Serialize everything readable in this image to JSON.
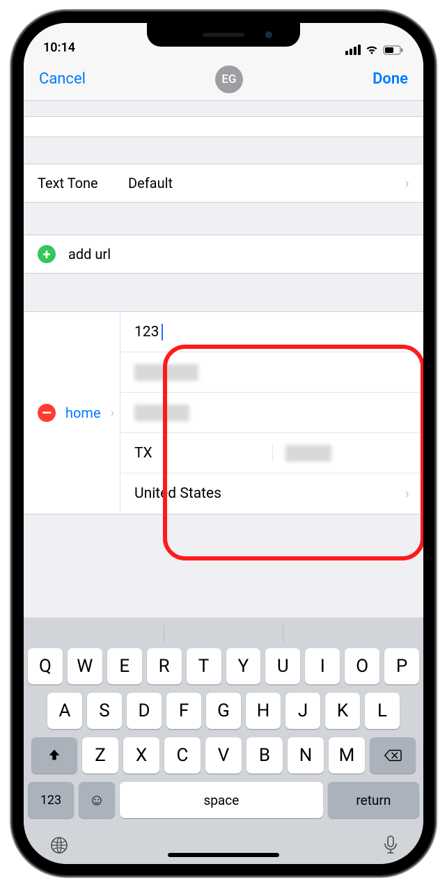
{
  "status": {
    "time": "10:14"
  },
  "nav": {
    "cancel": "Cancel",
    "done": "Done",
    "initials": "EG"
  },
  "text_tone": {
    "label": "Text Tone",
    "value": "Default"
  },
  "add_url": {
    "label": "add url"
  },
  "address": {
    "type_label": "home",
    "street1": "123",
    "state": "TX",
    "country": "United States"
  },
  "keyboard": {
    "row1": [
      "Q",
      "W",
      "E",
      "R",
      "T",
      "Y",
      "U",
      "I",
      "O",
      "P"
    ],
    "row2": [
      "A",
      "S",
      "D",
      "F",
      "G",
      "H",
      "J",
      "K",
      "L"
    ],
    "row3": [
      "Z",
      "X",
      "C",
      "V",
      "B",
      "N",
      "M"
    ],
    "numkey": "123",
    "space": "space",
    "return": "return"
  }
}
